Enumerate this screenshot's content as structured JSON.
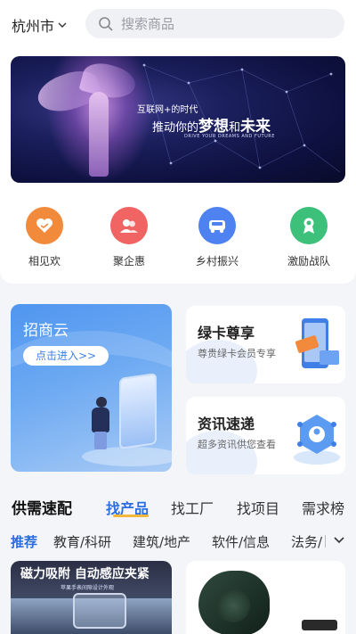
{
  "header": {
    "city": "杭州市",
    "search_placeholder": "搜索商品"
  },
  "banner": {
    "line1": "互联网+的时代",
    "line2_prefix": "推动你的",
    "line2_bold1": "梦想",
    "line2_mid": "和",
    "line2_bold2": "未来",
    "line3": "DRIVE YOUR DREAMS AND FUTURE"
  },
  "quick_links": [
    {
      "label": "相见欢",
      "icon": "heart-handshake-icon",
      "color": "#f28a3c"
    },
    {
      "label": "聚企惠",
      "icon": "people-icon",
      "color": "#f06464"
    },
    {
      "label": "乡村振兴",
      "icon": "truck-icon",
      "color": "#4e82f0"
    },
    {
      "label": "激励战队",
      "icon": "medal-icon",
      "color": "#3cc07a"
    }
  ],
  "promo": {
    "big": {
      "title": "招商云",
      "button": "点击进入>>"
    },
    "card1": {
      "title": "绿卡尊享",
      "subtitle": "尊贵绿卡会员专享"
    },
    "card2": {
      "title": "资讯速递",
      "subtitle": "超多资讯供您查看"
    }
  },
  "section": {
    "title": "供需速配",
    "tabs": [
      "找产品",
      "找工厂",
      "找项目",
      "需求榜"
    ],
    "active_tab": "找产品",
    "categories": [
      "推荐",
      "教育/科研",
      "建筑/地产",
      "软件/信息",
      "法务/"
    ],
    "active_category": "推荐"
  },
  "products": {
    "left": {
      "title": "磁力吸附 自动感应夹紧",
      "subtitle": "苹果手表间隙设计外观"
    }
  },
  "colors": {
    "accent": "#2c6de0",
    "tab_indicator": "#f5b73b"
  }
}
